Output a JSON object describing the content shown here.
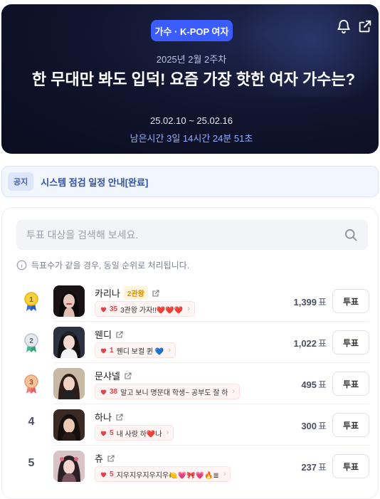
{
  "hero": {
    "category": "가수 · K-POP 여자",
    "week": "2025년 2월 2주차",
    "title": "한 무대만 봐도 입덕! 요즘 가장 핫한 여자 가수는?",
    "dates": "25.02.10 ~ 25.02.16",
    "remaining": "남은시간 3일 14시간 24분 51초",
    "icons": [
      "bell-icon",
      "share-icon"
    ]
  },
  "notice": {
    "tag": "공지",
    "text": "시스템 점검 일정 안내[완료]"
  },
  "search": {
    "placeholder": "투표 대상을 검색해 보세요."
  },
  "info_text": "득표수가 같을 경우, 동일 순위로 처리됩니다.",
  "vote_unit": "표",
  "vote_label": "투표",
  "ranking": [
    {
      "rank": "1",
      "name": "카리나",
      "title_badge": "2관왕",
      "cheer_count": "35",
      "cheer_text": "3관왕 가자!!❤️❤️❤️",
      "votes": "1,399"
    },
    {
      "rank": "2",
      "name": "웬디",
      "title_badge": "",
      "cheer_count": "1",
      "cheer_text": "웬디 보컬 퀸 💙",
      "votes": "1,022"
    },
    {
      "rank": "3",
      "name": "문샤넬",
      "title_badge": "",
      "cheer_count": "38",
      "cheer_text": "알고 보니 명문대 학생~ 공부도 잘 하",
      "votes": "495"
    },
    {
      "rank": "4",
      "name": "하나",
      "title_badge": "",
      "cheer_count": "5",
      "cheer_text": "내 사랑 하❤️나",
      "votes": "300"
    },
    {
      "rank": "5",
      "name": "츄",
      "title_badge": "",
      "cheer_count": "5",
      "cheer_text": "지우지우지우지우🍋💗🎀💗🔥≣",
      "votes": "237"
    }
  ],
  "colors": {
    "accent": "#3b5cff",
    "hero_bg": "#0f1430",
    "gold": "#f2b705",
    "silver": "#9aa3b3",
    "bronze": "#e79a6b",
    "heart": "#e0444e"
  }
}
